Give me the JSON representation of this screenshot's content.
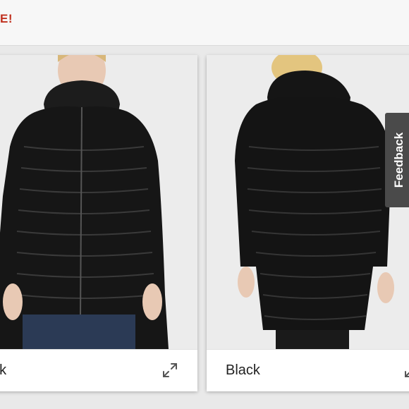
{
  "banner": {
    "promo_text": "E!"
  },
  "cards": [
    {
      "color_label": "ack",
      "image_alt": "Model wearing black hooded down parka, front view"
    },
    {
      "color_label": "Black",
      "image_alt": "Model wearing black hooded down parka, back view"
    }
  ],
  "feedback": {
    "label": "Feedback"
  },
  "colors": {
    "promo": "#c0301e",
    "feedback_bg": "#4a4a4a",
    "card_bg": "#ffffff",
    "page_bg": "#e9e9e9"
  },
  "icons": {
    "expand": "expand-arrows-icon"
  }
}
